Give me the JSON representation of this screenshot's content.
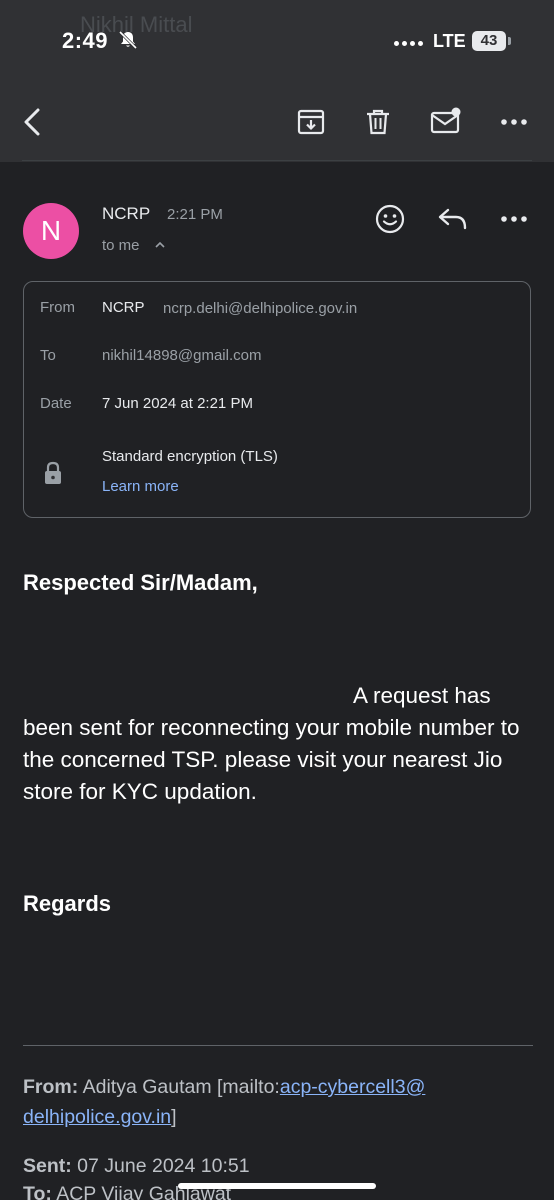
{
  "status_bar": {
    "ghost_title": "Nikhil Mittal",
    "time": "2:49",
    "network": "LTE",
    "battery": "43"
  },
  "toolbar": {
    "back_icon": "arrow-back-icon",
    "archive_icon": "archive-icon",
    "delete_icon": "trash-icon",
    "unread_icon": "mark-unread-icon",
    "more_icon": "more-horizontal-icon"
  },
  "message": {
    "avatar_letter": "N",
    "avatar_color": "#ec4fa4",
    "sender": "NCRP",
    "time": "2:21 PM",
    "recipient_summary": "to me",
    "details": {
      "from_label": "From",
      "from_name": "NCRP",
      "from_email": "ncrp.delhi@delhipolice.gov.in",
      "to_label": "To",
      "to_email": "nikhil14898@gmail.com",
      "date_label": "Date",
      "date_value": "7 Jun 2024 at 2:21 PM",
      "encryption": "Standard encryption (TLS)",
      "learn_more": "Learn more"
    },
    "body": {
      "greeting": "Respected Sir/Madam,",
      "paragraph": "A request has been sent for reconnecting your mobile number to the concerned TSP. please visit your nearest Jio store for KYC updation.",
      "regards": "Regards"
    },
    "quoted": {
      "from_label": "From:",
      "from_name": "Aditya Gautam [mailto:",
      "from_link1": "acp-cybercell3@",
      "from_link2": "delhipolice.gov.in",
      "from_close": "]",
      "sent_label": "Sent:",
      "sent_value": "07 June 2024 10:51",
      "to_label": "To:",
      "to_value": "ACP Vijay Gahlawat"
    }
  },
  "colors": {
    "background": "#202124",
    "header": "#303134",
    "link": "#8ab4f8"
  }
}
